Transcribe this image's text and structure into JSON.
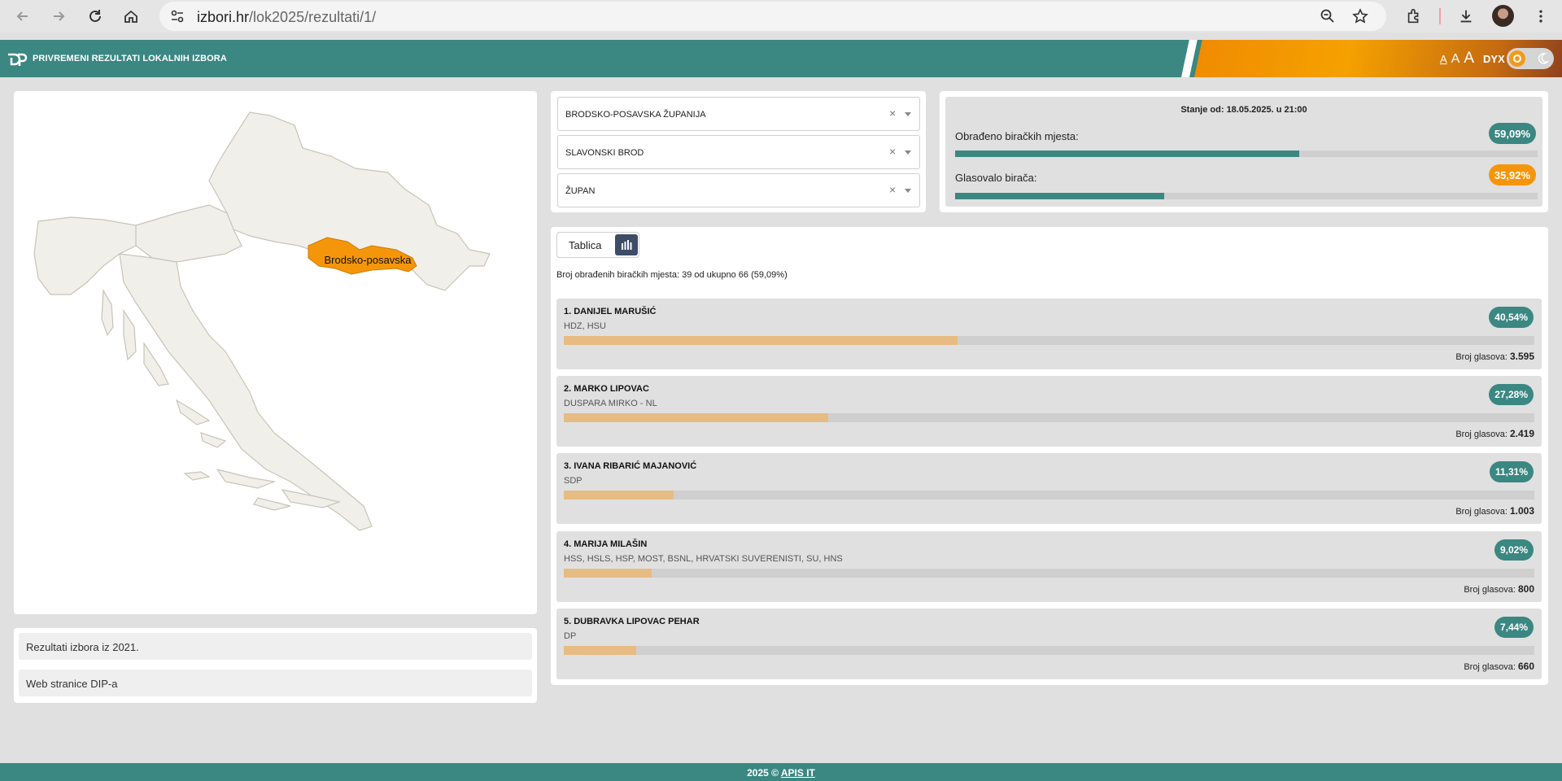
{
  "browser": {
    "url_host": "izbori.hr",
    "url_path": "/lok2025/rezultati/1/"
  },
  "header": {
    "title": "PRIVREMENI REZULTATI LOKALNIH IZBORA",
    "font_small": "A",
    "font_medium": "A",
    "font_large": "A",
    "dyslexia": "DYX"
  },
  "map": {
    "highlighted_region": "Brodsko-posavska",
    "highlight_color": "#f5960a"
  },
  "links": [
    {
      "label": "Rezultati izbora iz 2021."
    },
    {
      "label": "Web stranice DIP-a"
    }
  ],
  "filters": [
    {
      "value": "BRODSKO-POSAVSKA ŽUPANIJA"
    },
    {
      "value": "SLAVONSKI BROD"
    },
    {
      "value": "ŽUPAN"
    }
  ],
  "status": {
    "stanje": "Stanje od: 18.05.2025. u 21:00",
    "processed_label": "Obrađeno biračkih mjesta:",
    "processed_pct": "59,09%",
    "processed_value": 0.5909,
    "turnout_label": "Glasovalo birača:",
    "turnout_pct": "35,92%",
    "turnout_value": 0.3592
  },
  "results": {
    "tab_table": "Tablica",
    "processed_text": "Broj obrađenih biračkih mjesta: 39 od ukupno 66 (59,09%)",
    "votes_label": "Broj glasova:",
    "candidates": [
      {
        "name": "1. DANIJEL MARUŠIĆ",
        "party": "HDZ, HSU",
        "pct": "40,54%",
        "value": 0.4054,
        "votes": "3.595"
      },
      {
        "name": "2. MARKO LIPOVAC",
        "party": "DUSPARA MIRKO - NL",
        "pct": "27,28%",
        "value": 0.2728,
        "votes": "2.419"
      },
      {
        "name": "3. IVANA RIBARIĆ MAJANOVIĆ",
        "party": "SDP",
        "pct": "11,31%",
        "value": 0.1131,
        "votes": "1.003"
      },
      {
        "name": "4. MARIJA MILAŠIN",
        "party": "HSS, HSLS, HSP, MOST, BSNL, HRVATSKI SUVERENISTI, SU, HNS",
        "pct": "9,02%",
        "value": 0.0902,
        "votes": "800"
      },
      {
        "name": "5. DUBRAVKA LIPOVAC PEHAR",
        "party": "DP",
        "pct": "7,44%",
        "value": 0.0744,
        "votes": "660"
      }
    ]
  },
  "footer": {
    "copyright": "2025 ©",
    "link": "APIS IT"
  },
  "colors": {
    "teal": "#3b8782",
    "orange": "#f5960a",
    "bar_candidate": "#e7bc82"
  }
}
